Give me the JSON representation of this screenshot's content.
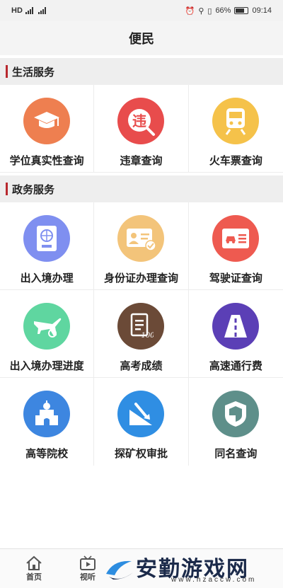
{
  "status_bar": {
    "network": "HD",
    "battery": "66%",
    "time": "09:14"
  },
  "header": {
    "title": "便民"
  },
  "sections": [
    {
      "title": "生活服务",
      "items": [
        {
          "label": "学位真实性查询",
          "icon": "graduation-cap-icon",
          "color": "#ee7f50"
        },
        {
          "label": "违章查询",
          "icon": "violation-icon",
          "color": "#e84c4c"
        },
        {
          "label": "火车票查询",
          "icon": "train-icon",
          "color": "#f5c24a"
        }
      ]
    },
    {
      "title": "政务服务",
      "items": [
        {
          "label": "出入境办理",
          "icon": "passport-icon",
          "color": "#7f8ff0"
        },
        {
          "label": "身份证办理查询",
          "icon": "id-card-icon",
          "color": "#f3c47a"
        },
        {
          "label": "驾驶证查询",
          "icon": "driver-license-icon",
          "color": "#ee5a50"
        },
        {
          "label": "出入境办理进度",
          "icon": "airplane-icon",
          "color": "#5fd6a0"
        },
        {
          "label": "高考成绩",
          "icon": "exam-score-icon",
          "color": "#6b4a37"
        },
        {
          "label": "高速通行费",
          "icon": "highway-icon",
          "color": "#5b3fb6"
        },
        {
          "label": "高等院校",
          "icon": "school-icon",
          "color": "#3d86e0"
        },
        {
          "label": "探矿权审批",
          "icon": "mining-icon",
          "color": "#2f8ee3"
        },
        {
          "label": "同名查询",
          "icon": "shield-icon",
          "color": "#5e8f8a"
        }
      ]
    }
  ],
  "tabbar": [
    {
      "label": "首页",
      "icon": "home-icon"
    },
    {
      "label": "视听",
      "icon": "tv-icon"
    }
  ],
  "watermark": {
    "text": "安勤游戏网",
    "sub": "www.hzaccw.com"
  }
}
